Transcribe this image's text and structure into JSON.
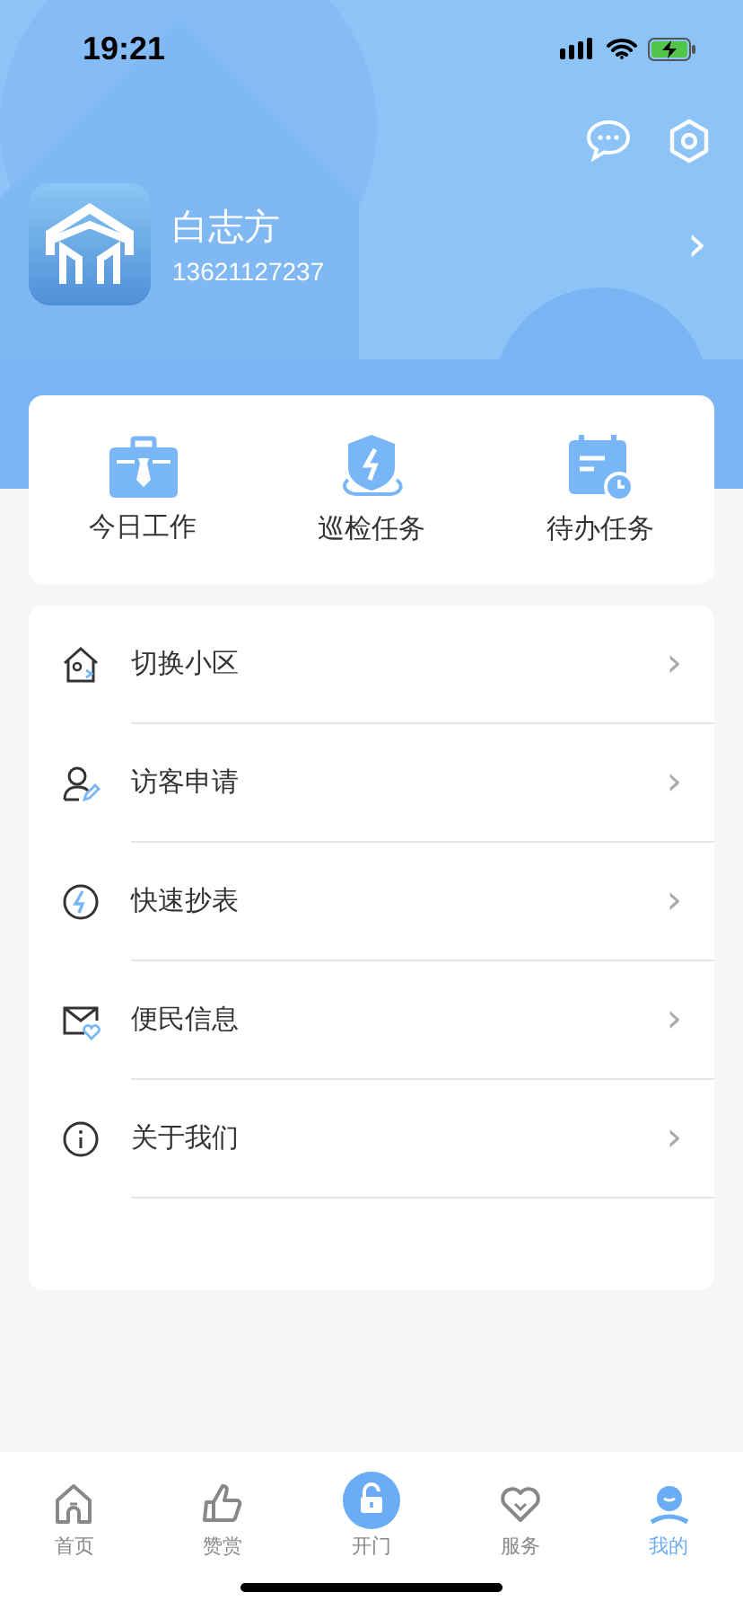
{
  "status_bar": {
    "time": "19:21"
  },
  "profile": {
    "name": "白志方",
    "phone": "13621127237",
    "chevron": "›"
  },
  "quick_actions": [
    {
      "kind": "briefcase",
      "label": "今日工作"
    },
    {
      "kind": "shield",
      "label": "巡检任务"
    },
    {
      "kind": "calendar",
      "label": "待办任务"
    }
  ],
  "menu": [
    {
      "kind": "house",
      "label": "切换小区",
      "chevron": "›"
    },
    {
      "kind": "visitor",
      "label": "访客申请",
      "chevron": "›"
    },
    {
      "kind": "bolt",
      "label": "快速抄表",
      "chevron": "›"
    },
    {
      "kind": "mail",
      "label": "便民信息",
      "chevron": "›"
    },
    {
      "kind": "info",
      "label": "关于我们",
      "chevron": "›"
    }
  ],
  "tab_bar": [
    {
      "kind": "home",
      "label": "首页",
      "selected": false
    },
    {
      "kind": "like",
      "label": "赞赏",
      "selected": false
    },
    {
      "kind": "door",
      "label": "开门",
      "selected": false
    },
    {
      "kind": "service",
      "label": "服务",
      "selected": false
    },
    {
      "kind": "me",
      "label": "我的",
      "selected": true
    }
  ]
}
